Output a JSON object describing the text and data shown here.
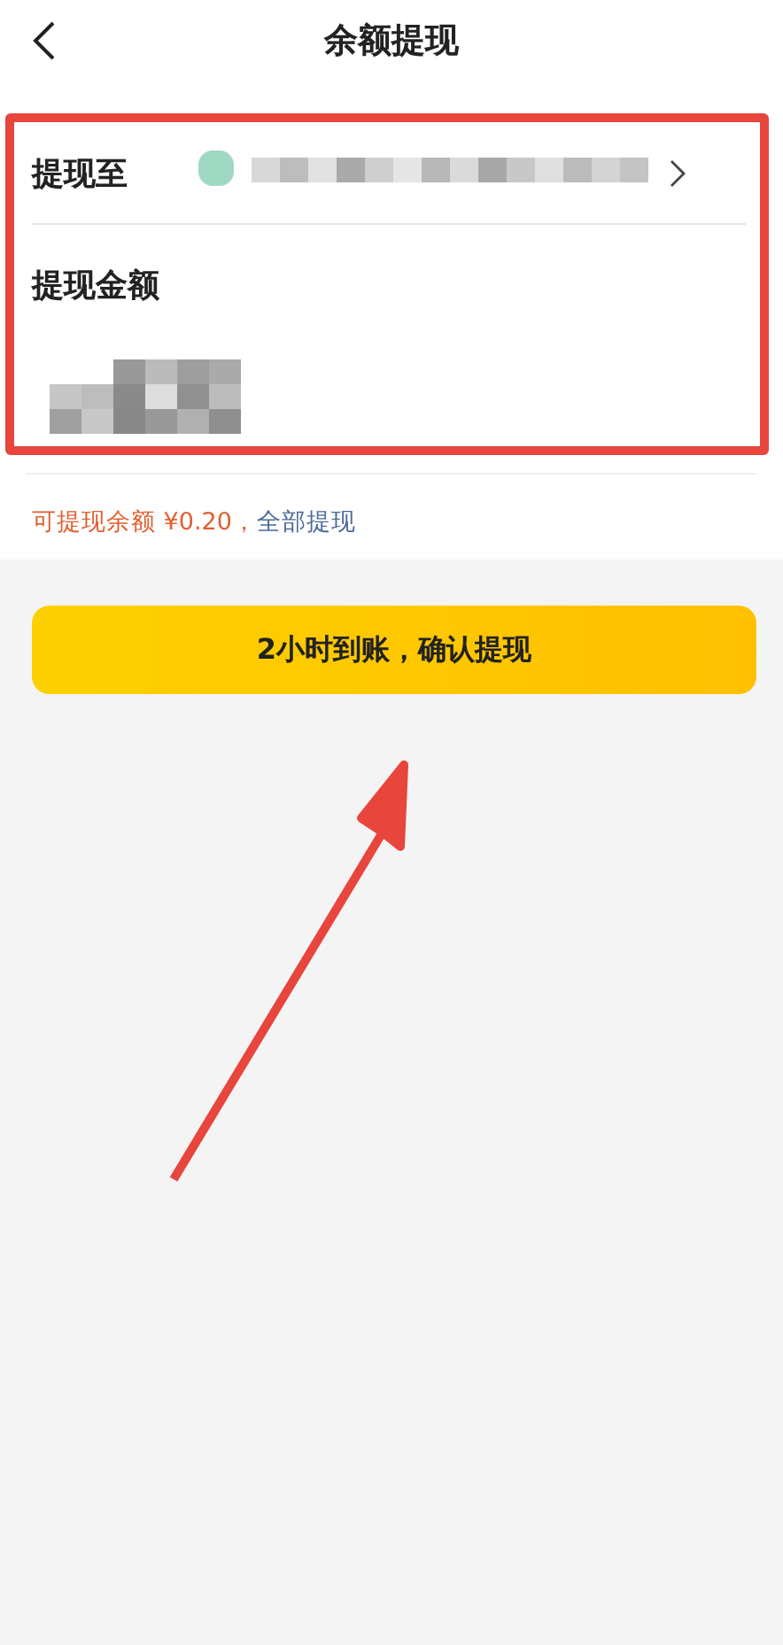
{
  "header": {
    "title": "余额提现"
  },
  "withdraw_to": {
    "label": "提现至"
  },
  "amount": {
    "label": "提现金额"
  },
  "balance": {
    "text": "可提现余额 ¥0.20，",
    "link": "全部提现"
  },
  "confirm_button": {
    "label": "2小时到账，确认提现"
  }
}
